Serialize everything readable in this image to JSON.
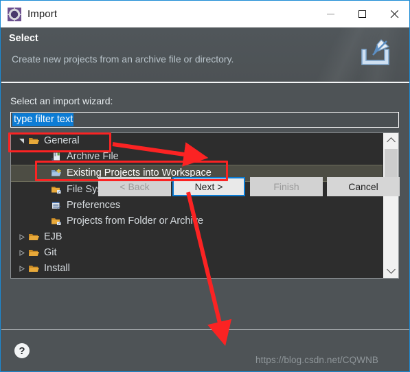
{
  "window": {
    "title": "Import",
    "icon": "eclipse-import-icon",
    "controls": [
      {
        "name": "minimize-button",
        "glyph": "minimize-icon"
      },
      {
        "name": "maximize-button",
        "glyph": "maximize-icon"
      },
      {
        "name": "close-button",
        "glyph": "close-icon"
      }
    ]
  },
  "header": {
    "title": "Select",
    "description": "Create new projects from an archive file or directory.",
    "icon": "import-wizard-banner-icon"
  },
  "form": {
    "label": "Select an import wizard:",
    "filter": {
      "value": "type filter text",
      "placeholder": "type filter text",
      "selected": true
    }
  },
  "tree": {
    "items": [
      {
        "label": "General",
        "icon": "folder-icon",
        "level": 1,
        "expanded": true,
        "twisty": "expanded",
        "selected": false
      },
      {
        "label": "Archive File",
        "icon": "archive-file-icon",
        "level": 2,
        "twisty": "none",
        "selected": false
      },
      {
        "label": "Existing Projects into Workspace",
        "icon": "existing-projects-icon",
        "level": 2,
        "twisty": "none",
        "selected": true
      },
      {
        "label": "File System",
        "icon": "file-system-icon",
        "level": 2,
        "twisty": "none",
        "selected": false
      },
      {
        "label": "Preferences",
        "icon": "preferences-icon",
        "level": 2,
        "twisty": "none",
        "selected": false
      },
      {
        "label": "Projects from Folder or Archive",
        "icon": "folder-archive-icon",
        "level": 2,
        "twisty": "none",
        "selected": false
      },
      {
        "label": "EJB",
        "icon": "folder-icon",
        "level": 1,
        "expanded": false,
        "twisty": "collapsed",
        "selected": false
      },
      {
        "label": "Git",
        "icon": "folder-icon",
        "level": 1,
        "expanded": false,
        "twisty": "collapsed",
        "selected": false
      },
      {
        "label": "Install",
        "icon": "folder-icon",
        "level": 1,
        "expanded": false,
        "twisty": "collapsed",
        "selected": false
      }
    ],
    "scrollbar": {
      "up": "scroll-up-icon",
      "down": "scroll-down-icon"
    }
  },
  "footer": {
    "help": "?",
    "buttons": [
      {
        "label": "< Back",
        "name": "back-button",
        "state": "disabled"
      },
      {
        "label": "Next >",
        "name": "next-button",
        "state": "focused"
      },
      {
        "label": "Finish",
        "name": "finish-button",
        "state": "disabled"
      },
      {
        "label": "Cancel",
        "name": "cancel-button",
        "state": "enabled"
      }
    ]
  },
  "annotations": {
    "color": "#fb2323",
    "watermark": "https://blog.csdn.net/CQWNB"
  }
}
